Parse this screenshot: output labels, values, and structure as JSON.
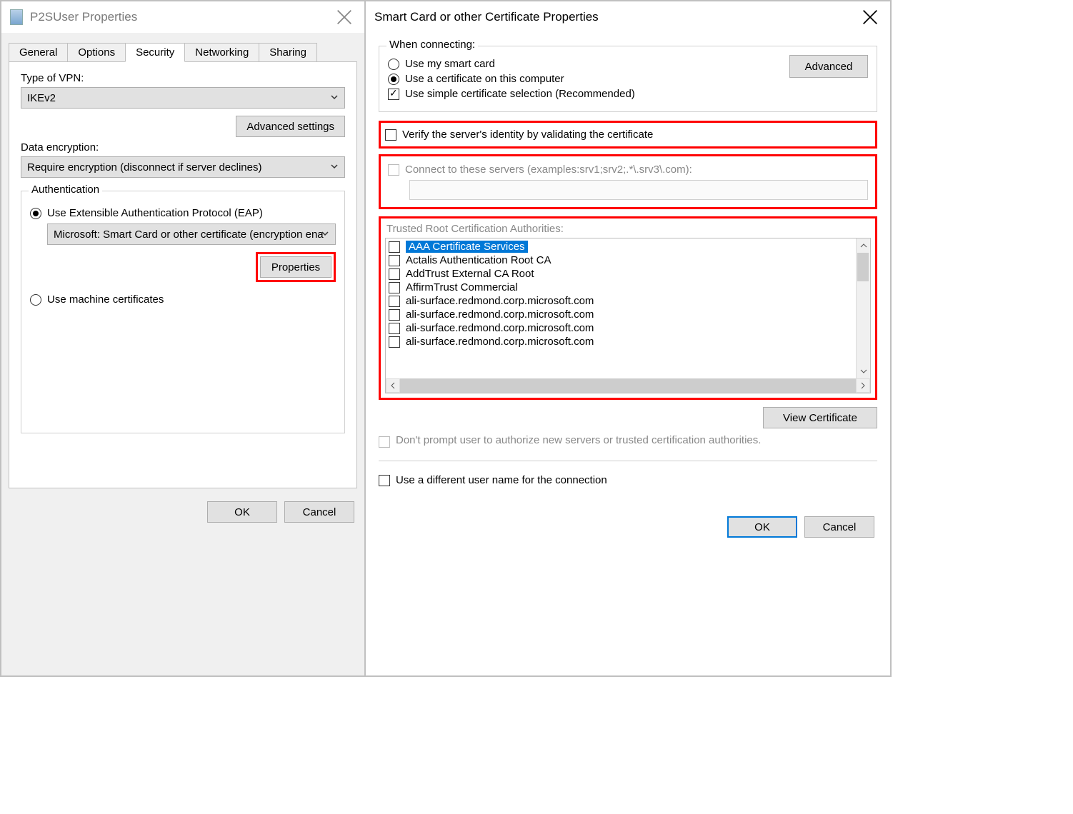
{
  "left": {
    "title": "P2SUser Properties",
    "tabs": [
      "General",
      "Options",
      "Security",
      "Networking",
      "Sharing"
    ],
    "activeTab": 2,
    "vpnTypeLabel": "Type of VPN:",
    "vpnType": "IKEv2",
    "advSettings": "Advanced settings",
    "encLabel": "Data encryption:",
    "enc": "Require encryption (disconnect if server declines)",
    "authLegend": "Authentication",
    "eapRadio": "Use Extensible Authentication Protocol (EAP)",
    "eapSelect": "Microsoft: Smart Card or other certificate (encryption ena",
    "propertiesBtn": "Properties",
    "machineRadio": "Use machine certificates",
    "ok": "OK",
    "cancel": "Cancel"
  },
  "right": {
    "title": "Smart Card or other Certificate Properties",
    "connLegend": "When connecting:",
    "useSmartCard": "Use my smart card",
    "useCert": "Use a certificate on this computer",
    "simpleSel": "Use simple certificate selection (Recommended)",
    "advancedBtn": "Advanced",
    "verifyServer": "Verify the server's identity by validating the certificate",
    "connectServers": "Connect to these servers (examples:srv1;srv2;.*\\.srv3\\.com):",
    "trustedLabel": "Trusted Root Certification Authorities:",
    "cas": [
      "AAA Certificate Services",
      "Actalis Authentication Root CA",
      "AddTrust External CA Root",
      "AffirmTrust Commercial",
      "ali-surface.redmond.corp.microsoft.com",
      "ali-surface.redmond.corp.microsoft.com",
      "ali-surface.redmond.corp.microsoft.com",
      "ali-surface.redmond.corp.microsoft.com"
    ],
    "viewCert": "View Certificate",
    "dontPrompt": "Don't prompt user to authorize new servers or trusted certification authorities.",
    "diffUser": "Use a different user name for the connection",
    "ok": "OK",
    "cancel": "Cancel"
  }
}
